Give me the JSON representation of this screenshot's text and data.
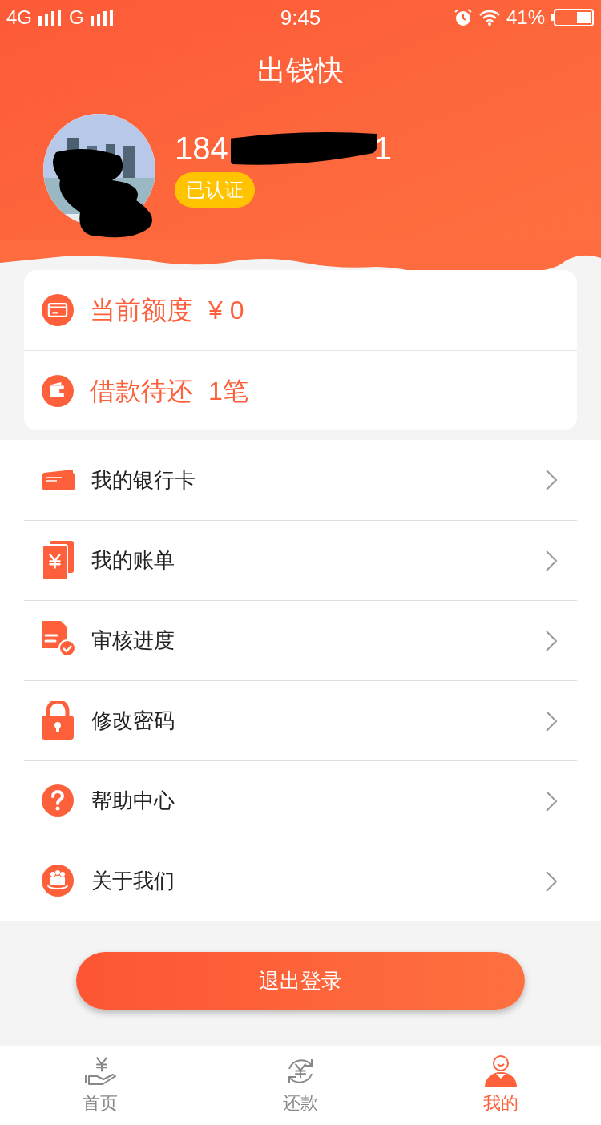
{
  "status_bar": {
    "network_primary": "4G",
    "network_secondary": "G",
    "time": "9:45",
    "battery": "41%"
  },
  "title": "出钱快",
  "profile": {
    "phone_start": "184",
    "phone_end": "1",
    "badge": "已认证"
  },
  "summary": [
    {
      "kind": "card",
      "label": "当前额度",
      "value": "¥ 0"
    },
    {
      "kind": "wallet",
      "label": "借款待还",
      "value": "1笔"
    }
  ],
  "menu": [
    {
      "kind": "bankcard",
      "label": "我的银行卡"
    },
    {
      "kind": "bill",
      "label": "我的账单"
    },
    {
      "kind": "review",
      "label": "审核进度"
    },
    {
      "kind": "lock",
      "label": "修改密码"
    },
    {
      "kind": "help",
      "label": "帮助中心"
    },
    {
      "kind": "about",
      "label": "关于我们"
    }
  ],
  "logout": "退出登录",
  "tabs": [
    {
      "kind": "home",
      "label": "首页",
      "selected": false
    },
    {
      "kind": "repay",
      "label": "还款",
      "selected": false
    },
    {
      "kind": "me",
      "label": "我的",
      "selected": true
    }
  ]
}
